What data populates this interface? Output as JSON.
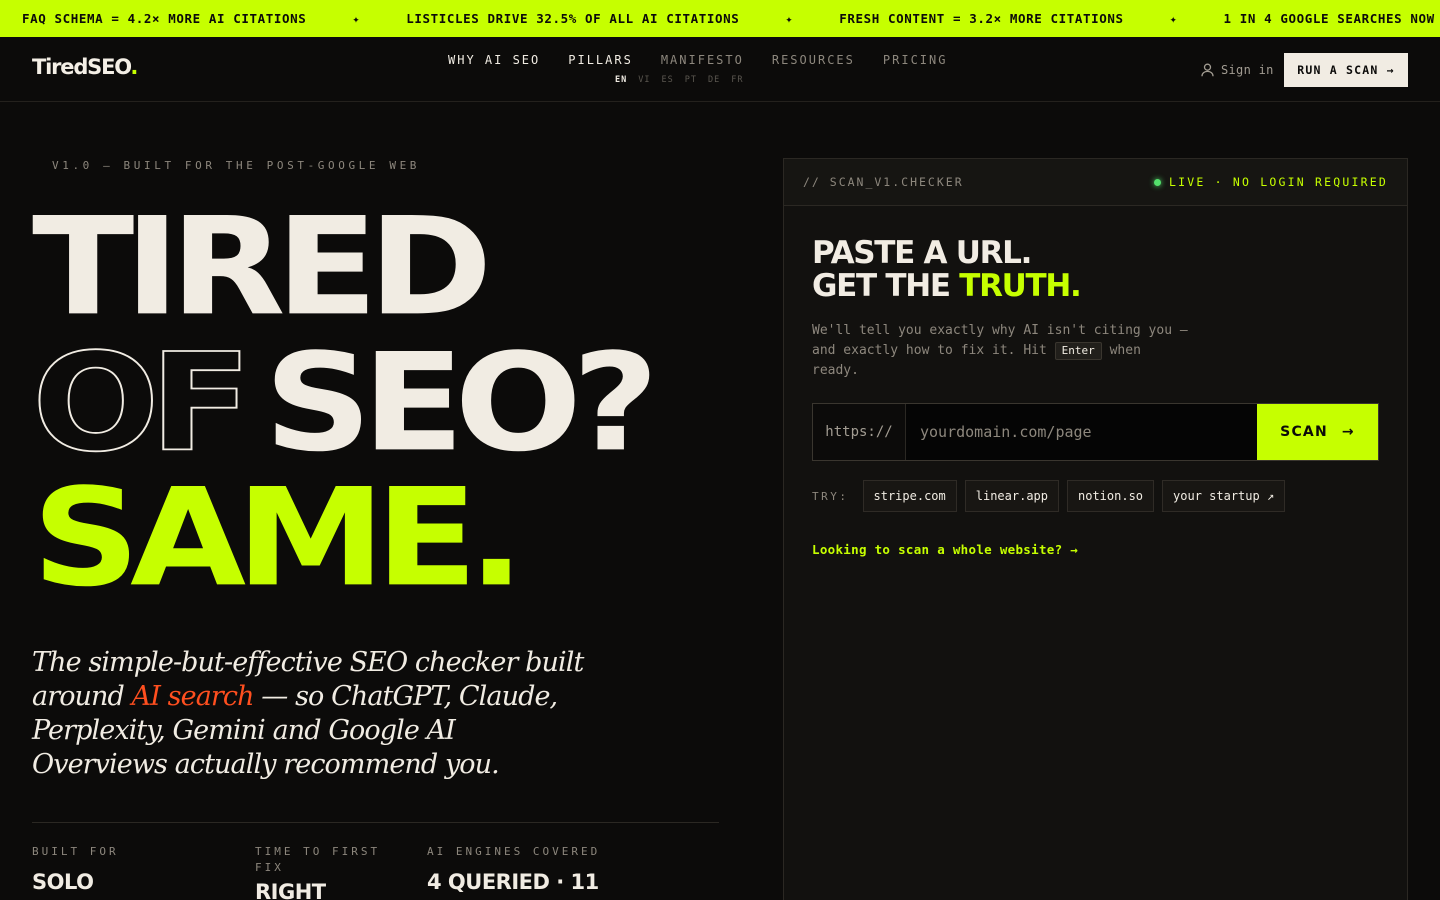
{
  "ticker": {
    "items": [
      "FAQ SCHEMA = 4.2× MORE AI CITATIONS",
      "LISTICLES DRIVE 32.5% OF ALL AI CITATIONS",
      "FRESH CONTENT = 3.2× MORE CITATIONS",
      "1 IN 4 GOOGLE SEARCHES NOW"
    ],
    "separator": "✦"
  },
  "nav": {
    "logo": "TiredSEO",
    "logo_dot": ".",
    "menu": [
      "WHY AI SEO",
      "PILLARS",
      "MANIFESTO",
      "RESOURCES",
      "PRICING"
    ],
    "languages": [
      "EN",
      "VI",
      "ES",
      "PT",
      "DE",
      "FR"
    ],
    "signin": "Sign in",
    "cta": "RUN A SCAN →"
  },
  "hero": {
    "eyebrow": "V1.0 — BUILT FOR THE POST-GOOGLE WEB",
    "line1": "TIRED",
    "line2_outline": "OF",
    "line2_solid": "SEO?",
    "line3": "SAME.",
    "lead_before": "The simple-but-effective SEO checker built around ",
    "lead_accent": "AI search",
    "lead_after": " — so ChatGPT, Claude, Perplexity, Gemini and Google AI Overviews actually recommend you.",
    "stats": [
      {
        "label": "BUILT FOR",
        "value": "SOLO"
      },
      {
        "label": "TIME TO FIRST FIX",
        "value": "RIGHT"
      },
      {
        "label": "AI ENGINES COVERED",
        "value": "4 QUERIED · 11"
      }
    ]
  },
  "scanner": {
    "header_title": "// SCAN_V1.CHECKER",
    "live_label": "LIVE · NO LOGIN REQUIRED",
    "title_line1": "PASTE A URL.",
    "title_line2_prefix": "GET THE ",
    "title_line2_highlight": "TRUTH.",
    "desc_before": "We'll tell you exactly why AI isn't citing you — and exactly how to fix it. Hit ",
    "desc_key": "Enter",
    "desc_after": " when ready.",
    "url_prefix": "https://",
    "url_placeholder": "yourdomain.com/page",
    "url_value": "",
    "scan_label": "SCAN",
    "scan_arrow": "→",
    "try_label": "TRY:",
    "examples": [
      "stripe.com",
      "linear.app",
      "notion.so",
      "your startup ↗"
    ],
    "whole_site_link": "Looking to scan a whole website? →"
  },
  "colors": {
    "accent": "#c6ff00",
    "background": "#0c0b0a",
    "text": "#f1ece3",
    "highlight": "#ff4f1f",
    "live": "#53e06b"
  }
}
